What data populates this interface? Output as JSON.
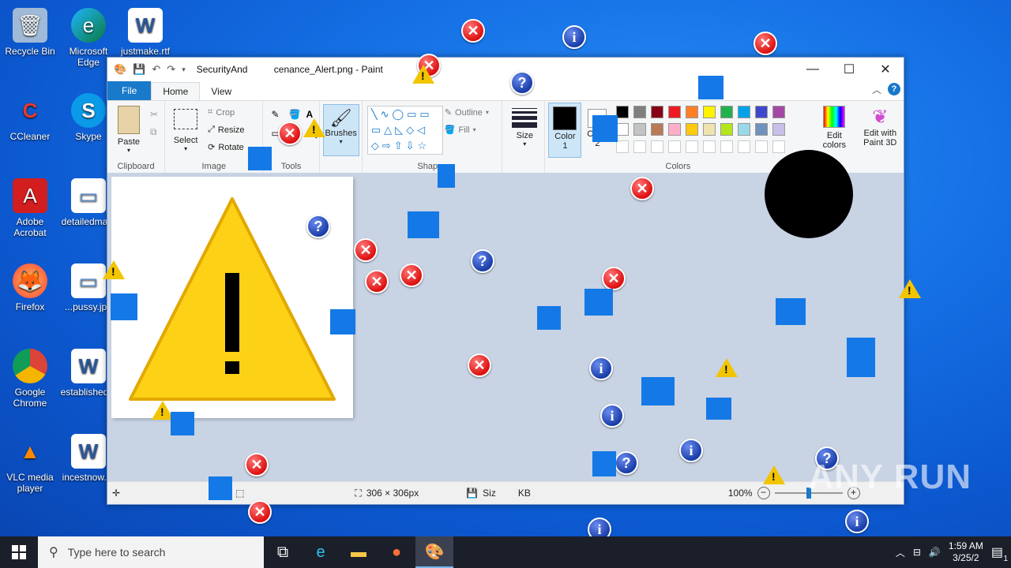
{
  "desktop_icons": [
    {
      "label": "Recycle Bin",
      "icon": "recycle-bin-icon"
    },
    {
      "label": "Microsoft Edge",
      "icon": "edge-icon"
    },
    {
      "label": "justmake.rtf",
      "icon": "word-doc-icon"
    },
    {
      "label": "CCleaner",
      "icon": "ccleaner-icon"
    },
    {
      "label": "Skype",
      "icon": "skype-icon"
    },
    {
      "label": "Adobe Acrobat",
      "icon": "acrobat-icon"
    },
    {
      "label": "detailedma...",
      "icon": "image-file-icon"
    },
    {
      "label": "Firefox",
      "icon": "firefox-icon"
    },
    {
      "label": "...pussy.jpg",
      "icon": "image-file-icon"
    },
    {
      "label": "Google Chrome",
      "icon": "chrome-icon"
    },
    {
      "label": "established...",
      "icon": "word-doc-icon"
    },
    {
      "label": "VLC media player",
      "icon": "vlc-icon"
    },
    {
      "label": "incestnow.rtf",
      "icon": "word-doc-icon"
    }
  ],
  "window": {
    "title": "SecurityAnd...cenance_Alert.png - Paint",
    "title_left": "SecurityAnd",
    "title_right": "cenance_Alert.png - Paint"
  },
  "tabs": {
    "file": "File",
    "home": "Home",
    "view": "View"
  },
  "ribbon": {
    "clipboard": {
      "label": "Clipboard",
      "paste": "Paste"
    },
    "image": {
      "label": "Image",
      "select": "Select",
      "crop": "Crop",
      "resize": "Resize",
      "rotate": "Rotate"
    },
    "tools": {
      "label": "Tools"
    },
    "brushes": "Brushes",
    "shapes": {
      "label": "Shapes",
      "outline": "Outline",
      "fill": "Fill"
    },
    "size": "Size",
    "color1": "Color 1",
    "color2": "Color 2",
    "colors_label": "Colors",
    "edit_colors": "Edit colors",
    "edit_paint3d": "Edit with Paint 3D"
  },
  "palette": [
    "#000000",
    "#7f7f7f",
    "#880015",
    "#ed1c24",
    "#ff7f27",
    "#fff200",
    "#22b14c",
    "#00a2e8",
    "#3f48cc",
    "#a349a4",
    "#ffffff",
    "#c3c3c3",
    "#b97a57",
    "#ffaec9",
    "#ffc90e",
    "#efe4b0",
    "#b5e61d",
    "#99d9ea",
    "#7092be",
    "#c8bfe7"
  ],
  "status": {
    "dimensions": "306 × 306px",
    "size": "KB",
    "size_prefix": "Siz",
    "zoom": "100%"
  },
  "taskbar": {
    "search_placeholder": "Type here to search",
    "time": "1:59 AM",
    "date": "3/25/2",
    "notif_count": "1"
  },
  "watermark": "ANY RUN"
}
